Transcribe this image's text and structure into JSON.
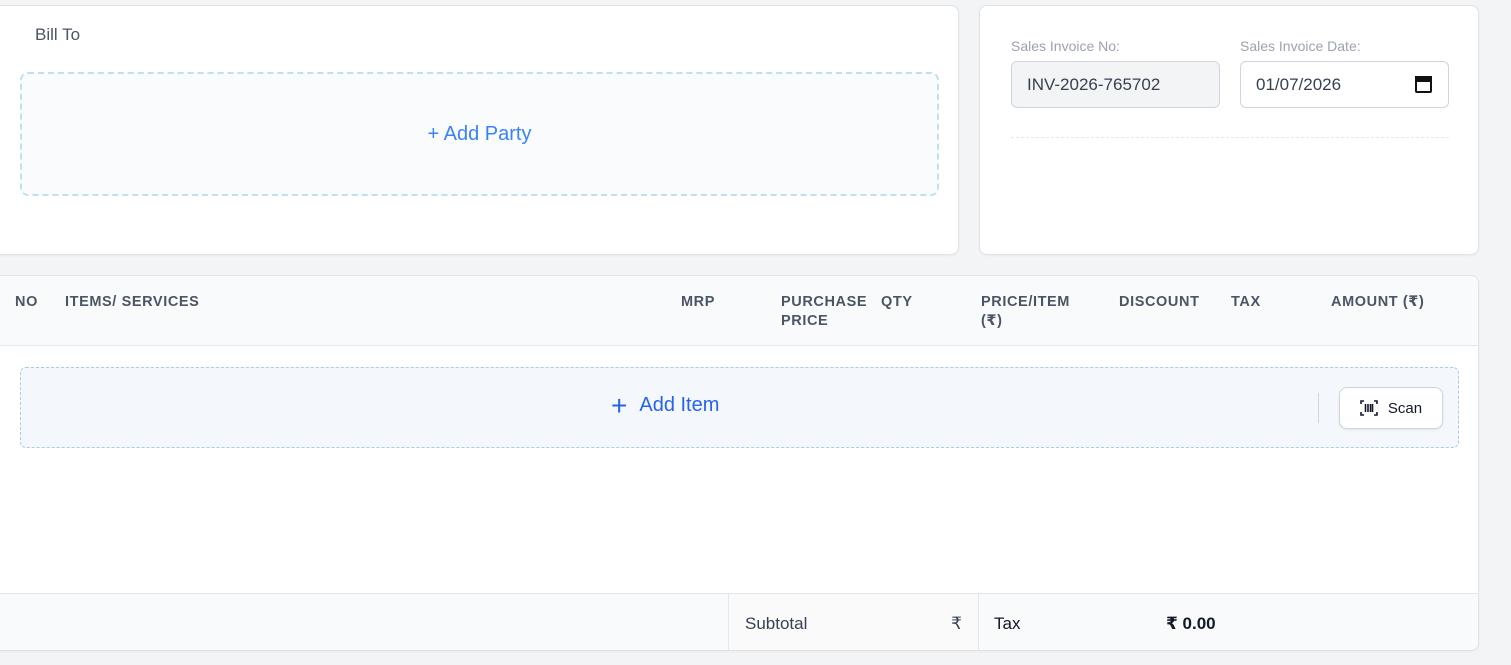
{
  "bill_to": {
    "title": "Bill To",
    "add_party_label": "+ Add Party"
  },
  "invoice": {
    "number_label": "Sales Invoice No:",
    "number_value": "INV-2026-765702",
    "date_label": "Sales Invoice Date:",
    "date_value": "01/07/2026"
  },
  "table": {
    "headers": {
      "no": "NO",
      "items": "ITEMS/ SERVICES",
      "mrp": "MRP",
      "purchase_price_1": "PURCHASE",
      "purchase_price_2": "PRICE",
      "qty": "QTY",
      "price_item_1": "PRICE/ITEM",
      "price_item_2": "(₹)",
      "discount": "DISCOUNT",
      "tax": "TAX",
      "amount": "AMOUNT (₹)"
    },
    "add_item_label": "Add Item",
    "scan_label": "Scan"
  },
  "totals": {
    "subtotal_label": "Subtotal",
    "subtotal_currency": "₹",
    "tax_label": "Tax",
    "tax_value": "₹ 0.00"
  },
  "colors": {
    "accent": "#2563eb",
    "dashed_border": "#bfe0ec",
    "header_bg": "#f9fafb"
  },
  "icons": {
    "date": "calendar-icon",
    "scan": "barcode-scan-icon",
    "add": "plus-icon"
  }
}
